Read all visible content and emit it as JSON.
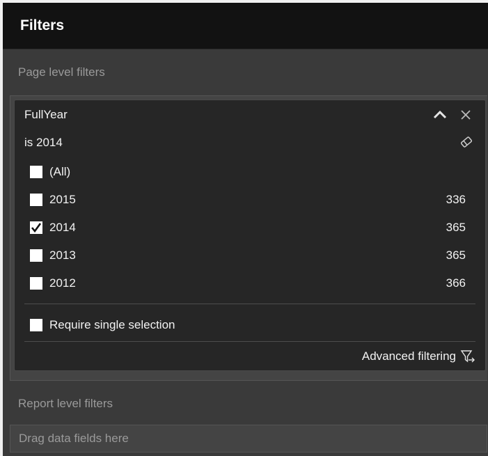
{
  "header": {
    "title": "Filters"
  },
  "page_level": {
    "label": "Page level filters"
  },
  "filter_card": {
    "field_name": "FullYear",
    "summary": "is 2014",
    "icons": {
      "collapse": "chevron-up-icon",
      "remove": "close-icon",
      "clear": "eraser-icon",
      "advanced": "funnel-arrow-icon"
    },
    "options": [
      {
        "label": "(All)",
        "count": "",
        "checked": false
      },
      {
        "label": "2015",
        "count": "336",
        "checked": false
      },
      {
        "label": "2014",
        "count": "365",
        "checked": true
      },
      {
        "label": "2013",
        "count": "365",
        "checked": false
      },
      {
        "label": "2012",
        "count": "366",
        "checked": false
      }
    ],
    "require_single": {
      "label": "Require single selection",
      "checked": false
    },
    "advanced_label": "Advanced filtering"
  },
  "report_level": {
    "label": "Report level filters"
  },
  "drag_zone": {
    "placeholder": "Drag data fields here"
  },
  "colors": {
    "header_bg": "#121212",
    "panel_bg": "#3a3a3a",
    "card_bg": "#262626",
    "text": "#f2f2f2",
    "muted_text": "#9a9a9a"
  }
}
